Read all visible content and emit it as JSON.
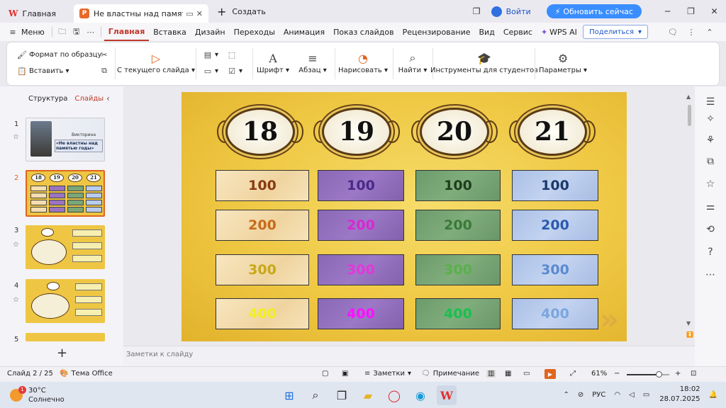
{
  "titlebar": {
    "home_tab": "Главная",
    "doc_tab": "Не властны над памятью год",
    "create": "Создать",
    "login": "Войти",
    "upgrade": "Обновить сейчас"
  },
  "menubar": {
    "menu": "Меню",
    "items": [
      "Главная",
      "Вставка",
      "Дизайн",
      "Переходы",
      "Анимация",
      "Показ слайдов",
      "Рецензирование",
      "Вид",
      "Сервис"
    ],
    "wps_ai": "WPS AI",
    "share": "Поделиться"
  },
  "ribbon": {
    "format_painter": "Формат по образцу",
    "paste": "Вставить",
    "from_current": "С текущего слайда",
    "font": "Шрифт",
    "paragraph": "Абзац",
    "draw": "Нарисовать",
    "find": "Найти",
    "students": "Инструменты для студентов",
    "params": "Параметры"
  },
  "leftpanel": {
    "tab_structure": "Структура",
    "tab_slides": "Слайды",
    "slides": [
      {
        "num": "1"
      },
      {
        "num": "2"
      },
      {
        "num": "3"
      },
      {
        "num": "4"
      },
      {
        "num": "5"
      }
    ],
    "thumb1_small": "Викторина",
    "thumb1_title": "«Не властны над памятью годы»"
  },
  "slide": {
    "columns": [
      {
        "year": "18",
        "color": "beige",
        "text_colors": [
          "#8a3a12",
          "#c86a1a",
          "#c8a818",
          "#f0f020"
        ]
      },
      {
        "year": "19",
        "color": "purple",
        "text_colors": [
          "#4a2a88",
          "#d62ad0",
          "#e238d8",
          "#ff10ff"
        ]
      },
      {
        "year": "20",
        "color": "green",
        "text_colors": [
          "#1e3e1e",
          "#3a7a3a",
          "#5ab04a",
          "#18c050"
        ]
      },
      {
        "year": "21",
        "color": "blue",
        "text_colors": [
          "#1a3a6e",
          "#2a5ab0",
          "#5a8ad0",
          "#7aa6e0"
        ]
      }
    ],
    "values": [
      "100",
      "200",
      "300",
      "400"
    ]
  },
  "notes_placeholder": "Заметки к слайду",
  "statusbar": {
    "slide_counter": "Слайд 2 / 25",
    "theme": "Тема Office",
    "notes": "Заметки",
    "comments": "Примечание",
    "zoom": "61%",
    "zoom_fraction": 0.61
  },
  "taskbar": {
    "temp": "30°C",
    "weather": "Солнечно",
    "badge": "1",
    "lang": "РУС",
    "time": "18:02",
    "date": "28.07.2025"
  }
}
